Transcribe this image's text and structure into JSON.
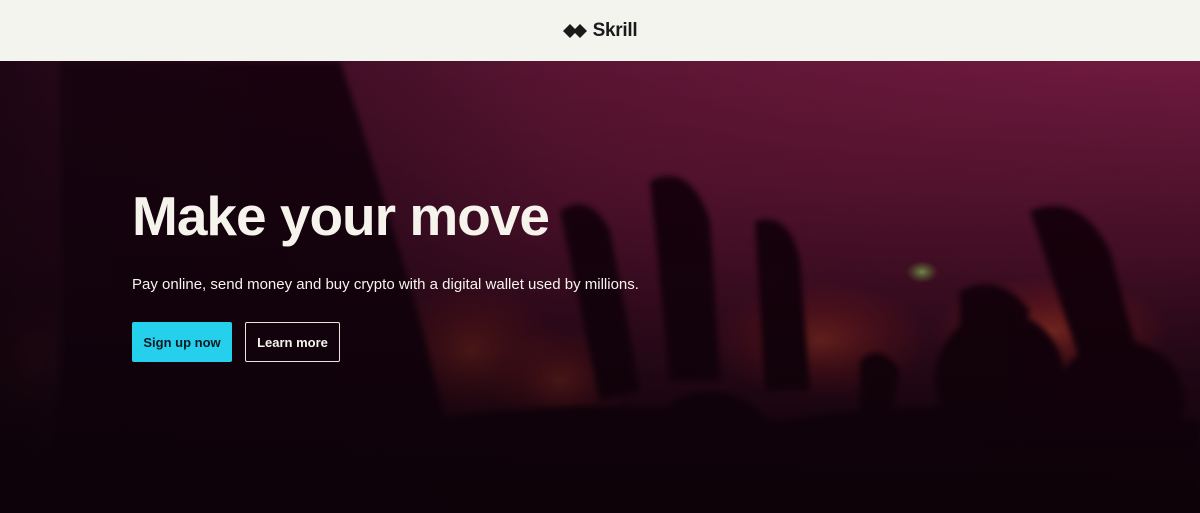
{
  "header": {
    "brand_name": "Skrill",
    "logo_icon": "skrill-diamonds-icon"
  },
  "hero": {
    "title": "Make your move",
    "subtitle": "Pay online, send money and buy crypto with a digital wallet used by millions.",
    "primary_button": "Sign up now",
    "secondary_button": "Learn more",
    "background_image": "concert-crowd-photo"
  },
  "colors": {
    "header_bg": "#f4f4ef",
    "primary_button_bg": "#25d0ec",
    "hero_text": "#f6f3ec"
  }
}
